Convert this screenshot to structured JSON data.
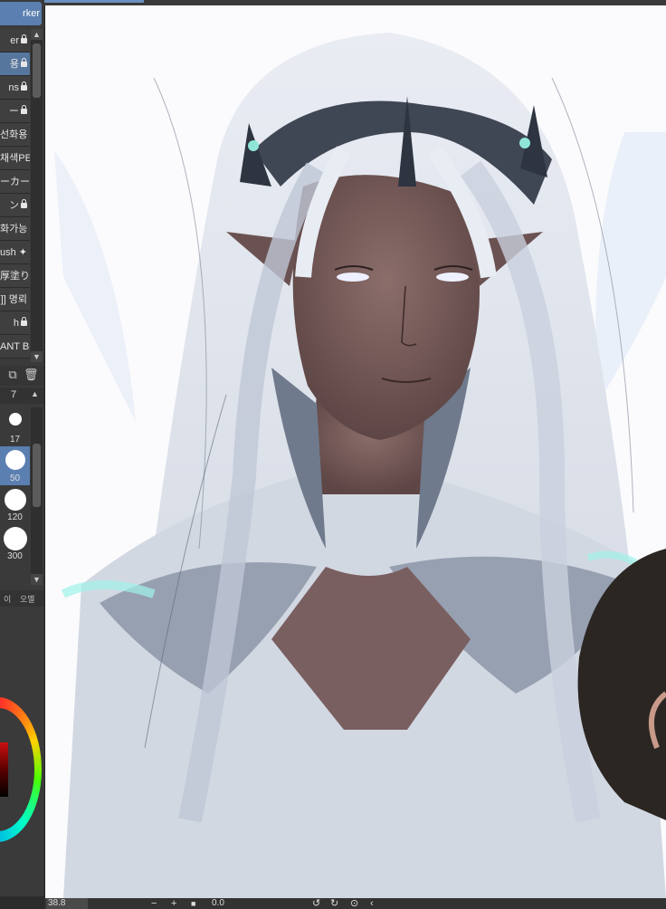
{
  "brush_panel": {
    "active_tab": "rker",
    "items": [
      {
        "label": "er",
        "locked": true,
        "selected": false
      },
      {
        "label": "용",
        "locked": true,
        "selected": true
      },
      {
        "label": "ns",
        "locked": true,
        "selected": false
      },
      {
        "label": "ー",
        "locked": true,
        "selected": false
      },
      {
        "label": "선화용",
        "locked": false,
        "selected": false
      },
      {
        "label": "채색PE",
        "locked": false,
        "selected": false
      },
      {
        "label": "ーカー",
        "locked": false,
        "selected": false
      },
      {
        "label": "ン",
        "locked": true,
        "selected": false
      },
      {
        "label": "화가능",
        "locked": false,
        "selected": false
      },
      {
        "label": "ush ✦",
        "locked": false,
        "selected": false
      },
      {
        "label": "厚塗り",
        "locked": false,
        "selected": false
      },
      {
        "label": "]] 명뢰",
        "locked": false,
        "selected": false
      },
      {
        "label": "h",
        "locked": true,
        "selected": false
      },
      {
        "label": "ANT B",
        "locked": false,
        "selected": false
      }
    ]
  },
  "brush_size": {
    "header_value": "7",
    "sizes": [
      {
        "label": "17",
        "selected": false
      },
      {
        "label": "50",
        "selected": true
      },
      {
        "label": "120",
        "selected": false
      },
      {
        "label": "300",
        "selected": false
      }
    ]
  },
  "bottom_tabs": {
    "left": "이",
    "right": "오멸"
  },
  "statusbar": {
    "zoom": "38.8",
    "rotation": "0.0"
  },
  "colors": {
    "accent": "#5a7fb0",
    "panel": "#3a3a3a",
    "canvas": "#fbfbfd"
  }
}
